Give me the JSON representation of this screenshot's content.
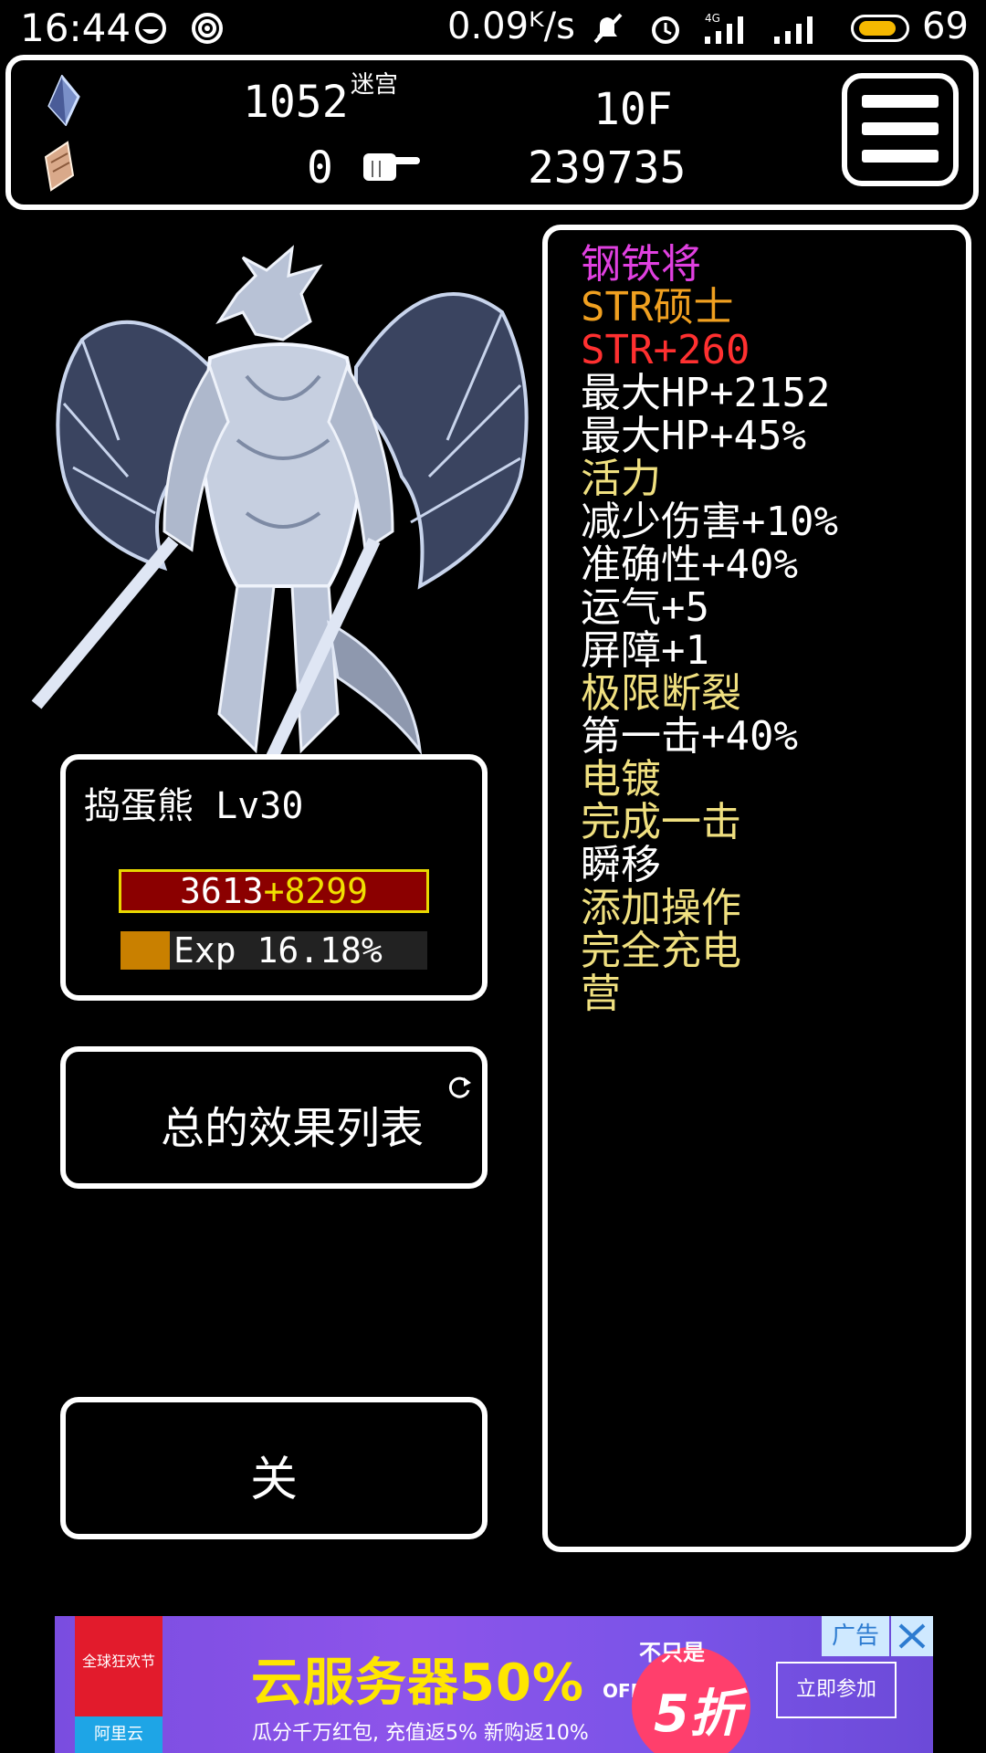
{
  "status_bar": {
    "time": "16:44",
    "network_speed": "0.09ᴷ/s",
    "network_type": "4G",
    "battery_percent": "69",
    "icons": [
      "face-icon",
      "hotspot-icon",
      "mute-icon",
      "alarm-icon",
      "signal-4g-icon",
      "signal-icon",
      "battery-icon"
    ]
  },
  "hud": {
    "crystal_count": "1052",
    "mode_label": "迷宫",
    "floor": "10F",
    "scroll_count": "0",
    "gold": "239735"
  },
  "character": {
    "name_level": "捣蛋熊 Lv30",
    "hp_current": "3613",
    "hp_bonus": "+8299",
    "exp_fraction": 0.1618,
    "exp_text": "Exp 16.18%"
  },
  "buttons": {
    "effects_list": "总的效果列表",
    "close": "关"
  },
  "effects": [
    {
      "text": "钢铁将",
      "color": "#e040e0"
    },
    {
      "text": "STR硕士",
      "color": "#f0a020"
    },
    {
      "text": "STR+260",
      "color": "#ff3030"
    },
    {
      "text": "最大HP+2152",
      "color": "#ffffff"
    },
    {
      "text": "最大HP+45%",
      "color": "#ffffff"
    },
    {
      "text": "活力",
      "color": "#f0e080"
    },
    {
      "text": "减少伤害+10%",
      "color": "#ffffff"
    },
    {
      "text": "准确性+40%",
      "color": "#ffffff"
    },
    {
      "text": "运气+5",
      "color": "#ffffff"
    },
    {
      "text": "屏障+1",
      "color": "#ffffff"
    },
    {
      "text": "极限断裂",
      "color": "#f0e080"
    },
    {
      "text": "第一击+40%",
      "color": "#ffffff"
    },
    {
      "text": "电镀",
      "color": "#f0e080"
    },
    {
      "text": "完成一击",
      "color": "#f0e080"
    },
    {
      "text": "瞬移",
      "color": "#ffffff"
    },
    {
      "text": "添加操作",
      "color": "#f0e080"
    },
    {
      "text": "完全充电",
      "color": "#f0e080"
    },
    {
      "text": "营",
      "color": "#f0e080"
    }
  ],
  "ad": {
    "event": "全球狂欢节",
    "brand": "阿里云",
    "headline": "云服务器50%",
    "percent_off": "OFF",
    "subline": "瓜分千万红包, 充值返5% 新购返10%",
    "not_only": "不只是",
    "discount": "5折",
    "join": "立即参加",
    "label": "广告"
  },
  "colors": {
    "hp_bar_bg": "#8b0000",
    "hp_bar_border": "#e8d800",
    "exp_fill": "#c98000",
    "panel_border": "#ffffff"
  }
}
